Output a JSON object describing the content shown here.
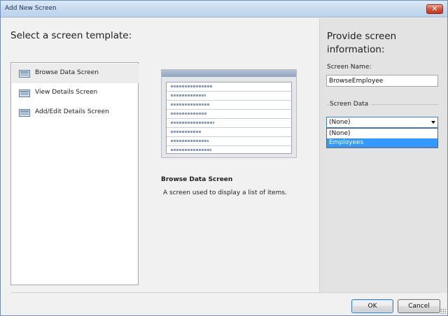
{
  "window": {
    "title": "Add New Screen"
  },
  "left": {
    "heading": "Select a screen template:",
    "templates": [
      {
        "label": "Browse Data Screen",
        "selected": true,
        "icon": "grid-screen-icon"
      },
      {
        "label": "View Details Screen",
        "selected": false,
        "icon": "details-screen-icon"
      },
      {
        "label": "Add/Edit Details Screen",
        "selected": false,
        "icon": "edit-screen-icon"
      }
    ],
    "description": {
      "title": "Browse Data Screen",
      "text": "A screen used to display a list of items."
    }
  },
  "right": {
    "heading": "Provide screen information:",
    "screen_name_label": "Screen Name:",
    "screen_name_value": "BrowseEmployee",
    "screen_data_label": "Screen Data",
    "screen_data_selected": "(None)",
    "dropdown_options": [
      {
        "label": "(None)",
        "highlighted": false
      },
      {
        "label": "Employees",
        "highlighted": true
      }
    ]
  },
  "buttons": {
    "ok": "OK",
    "cancel": "Cancel"
  },
  "colors": {
    "highlight": "#3399ff",
    "focus_border": "#3c7fb1"
  }
}
